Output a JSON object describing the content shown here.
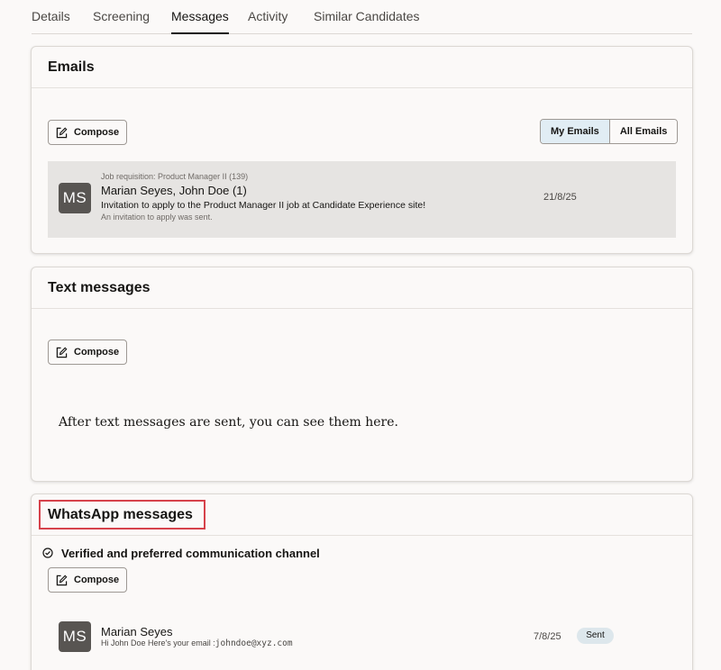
{
  "tabs": [
    "Details",
    "Screening",
    "Messages",
    "Activity",
    "Similar Candidates"
  ],
  "emails": {
    "title": "Emails",
    "compose_label": "Compose",
    "filter": {
      "my_emails": "My Emails",
      "all_emails": "All Emails",
      "selected": "My Emails"
    },
    "items": [
      {
        "avatar": "MS",
        "requisition": "Job requisition: Product Manager II (139)",
        "participants": "Marian Seyes, John Doe (1)",
        "subject": "Invitation to apply to the Product Manager II job at Candidate Experience site!",
        "summary": "An invitation to apply was sent.",
        "date": "21/8/25"
      }
    ]
  },
  "text_messages": {
    "title": "Text messages",
    "compose_label": "Compose",
    "empty_text": "After text messages are sent, you can see them here."
  },
  "whatsapp": {
    "title": "WhatsApp messages",
    "verified_text": "Verified and preferred communication channel",
    "compose_label": "Compose",
    "items": [
      {
        "avatar": "MS",
        "name": "Marian Seyes",
        "preview": "Hi John Doe Here's your email :",
        "preview_code": "johndoe@xyz.com",
        "date": "7/8/25",
        "status": "Sent"
      }
    ]
  }
}
